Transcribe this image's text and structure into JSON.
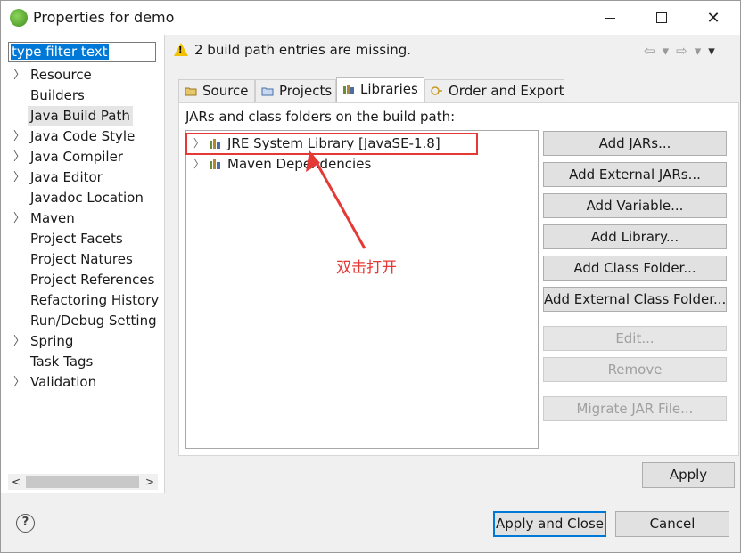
{
  "window": {
    "title": "Properties for demo"
  },
  "sidebar": {
    "filter_placeholder": "type filter text",
    "items": [
      {
        "label": "Resource",
        "expandable": true
      },
      {
        "label": "Builders",
        "expandable": false
      },
      {
        "label": "Java Build Path",
        "expandable": false,
        "selected": true
      },
      {
        "label": "Java Code Style",
        "expandable": true
      },
      {
        "label": "Java Compiler",
        "expandable": true
      },
      {
        "label": "Java Editor",
        "expandable": true
      },
      {
        "label": "Javadoc Location",
        "expandable": false
      },
      {
        "label": "Maven",
        "expandable": true
      },
      {
        "label": "Project Facets",
        "expandable": false
      },
      {
        "label": "Project Natures",
        "expandable": false
      },
      {
        "label": "Project References",
        "expandable": false
      },
      {
        "label": "Refactoring History",
        "expandable": false
      },
      {
        "label": "Run/Debug Setting",
        "expandable": false
      },
      {
        "label": "Spring",
        "expandable": true
      },
      {
        "label": "Task Tags",
        "expandable": false
      },
      {
        "label": "Validation",
        "expandable": true
      }
    ]
  },
  "warning": {
    "text": "2 build path entries are missing."
  },
  "tabs": [
    {
      "label": "Source",
      "icon": "source-folder-icon"
    },
    {
      "label": "Projects",
      "icon": "projects-icon"
    },
    {
      "label": "Libraries",
      "icon": "libraries-icon",
      "active": true
    },
    {
      "label": "Order and Export",
      "icon": "order-export-icon"
    }
  ],
  "libraries": {
    "heading": "JARs and class folders on the build path:",
    "entries": [
      {
        "label": "JRE System Library [JavaSE-1.8]",
        "highlighted": true
      },
      {
        "label": "Maven Dependencies"
      }
    ]
  },
  "annotation": {
    "text": "双击打开",
    "color": "#e53935"
  },
  "buttons": {
    "add_jars": "Add JARs...",
    "add_external_jars": "Add External JARs...",
    "add_variable": "Add Variable...",
    "add_library": "Add Library...",
    "add_class_folder": "Add Class Folder...",
    "add_external_class_folder": "Add External Class Folder...",
    "edit": "Edit...",
    "remove": "Remove",
    "migrate_jar": "Migrate JAR File...",
    "apply": "Apply",
    "apply_and_close": "Apply and Close",
    "cancel": "Cancel",
    "help": "?"
  },
  "colors": {
    "accent": "#0078d7",
    "warning": "#f2c200",
    "highlight_box": "#e53935"
  }
}
